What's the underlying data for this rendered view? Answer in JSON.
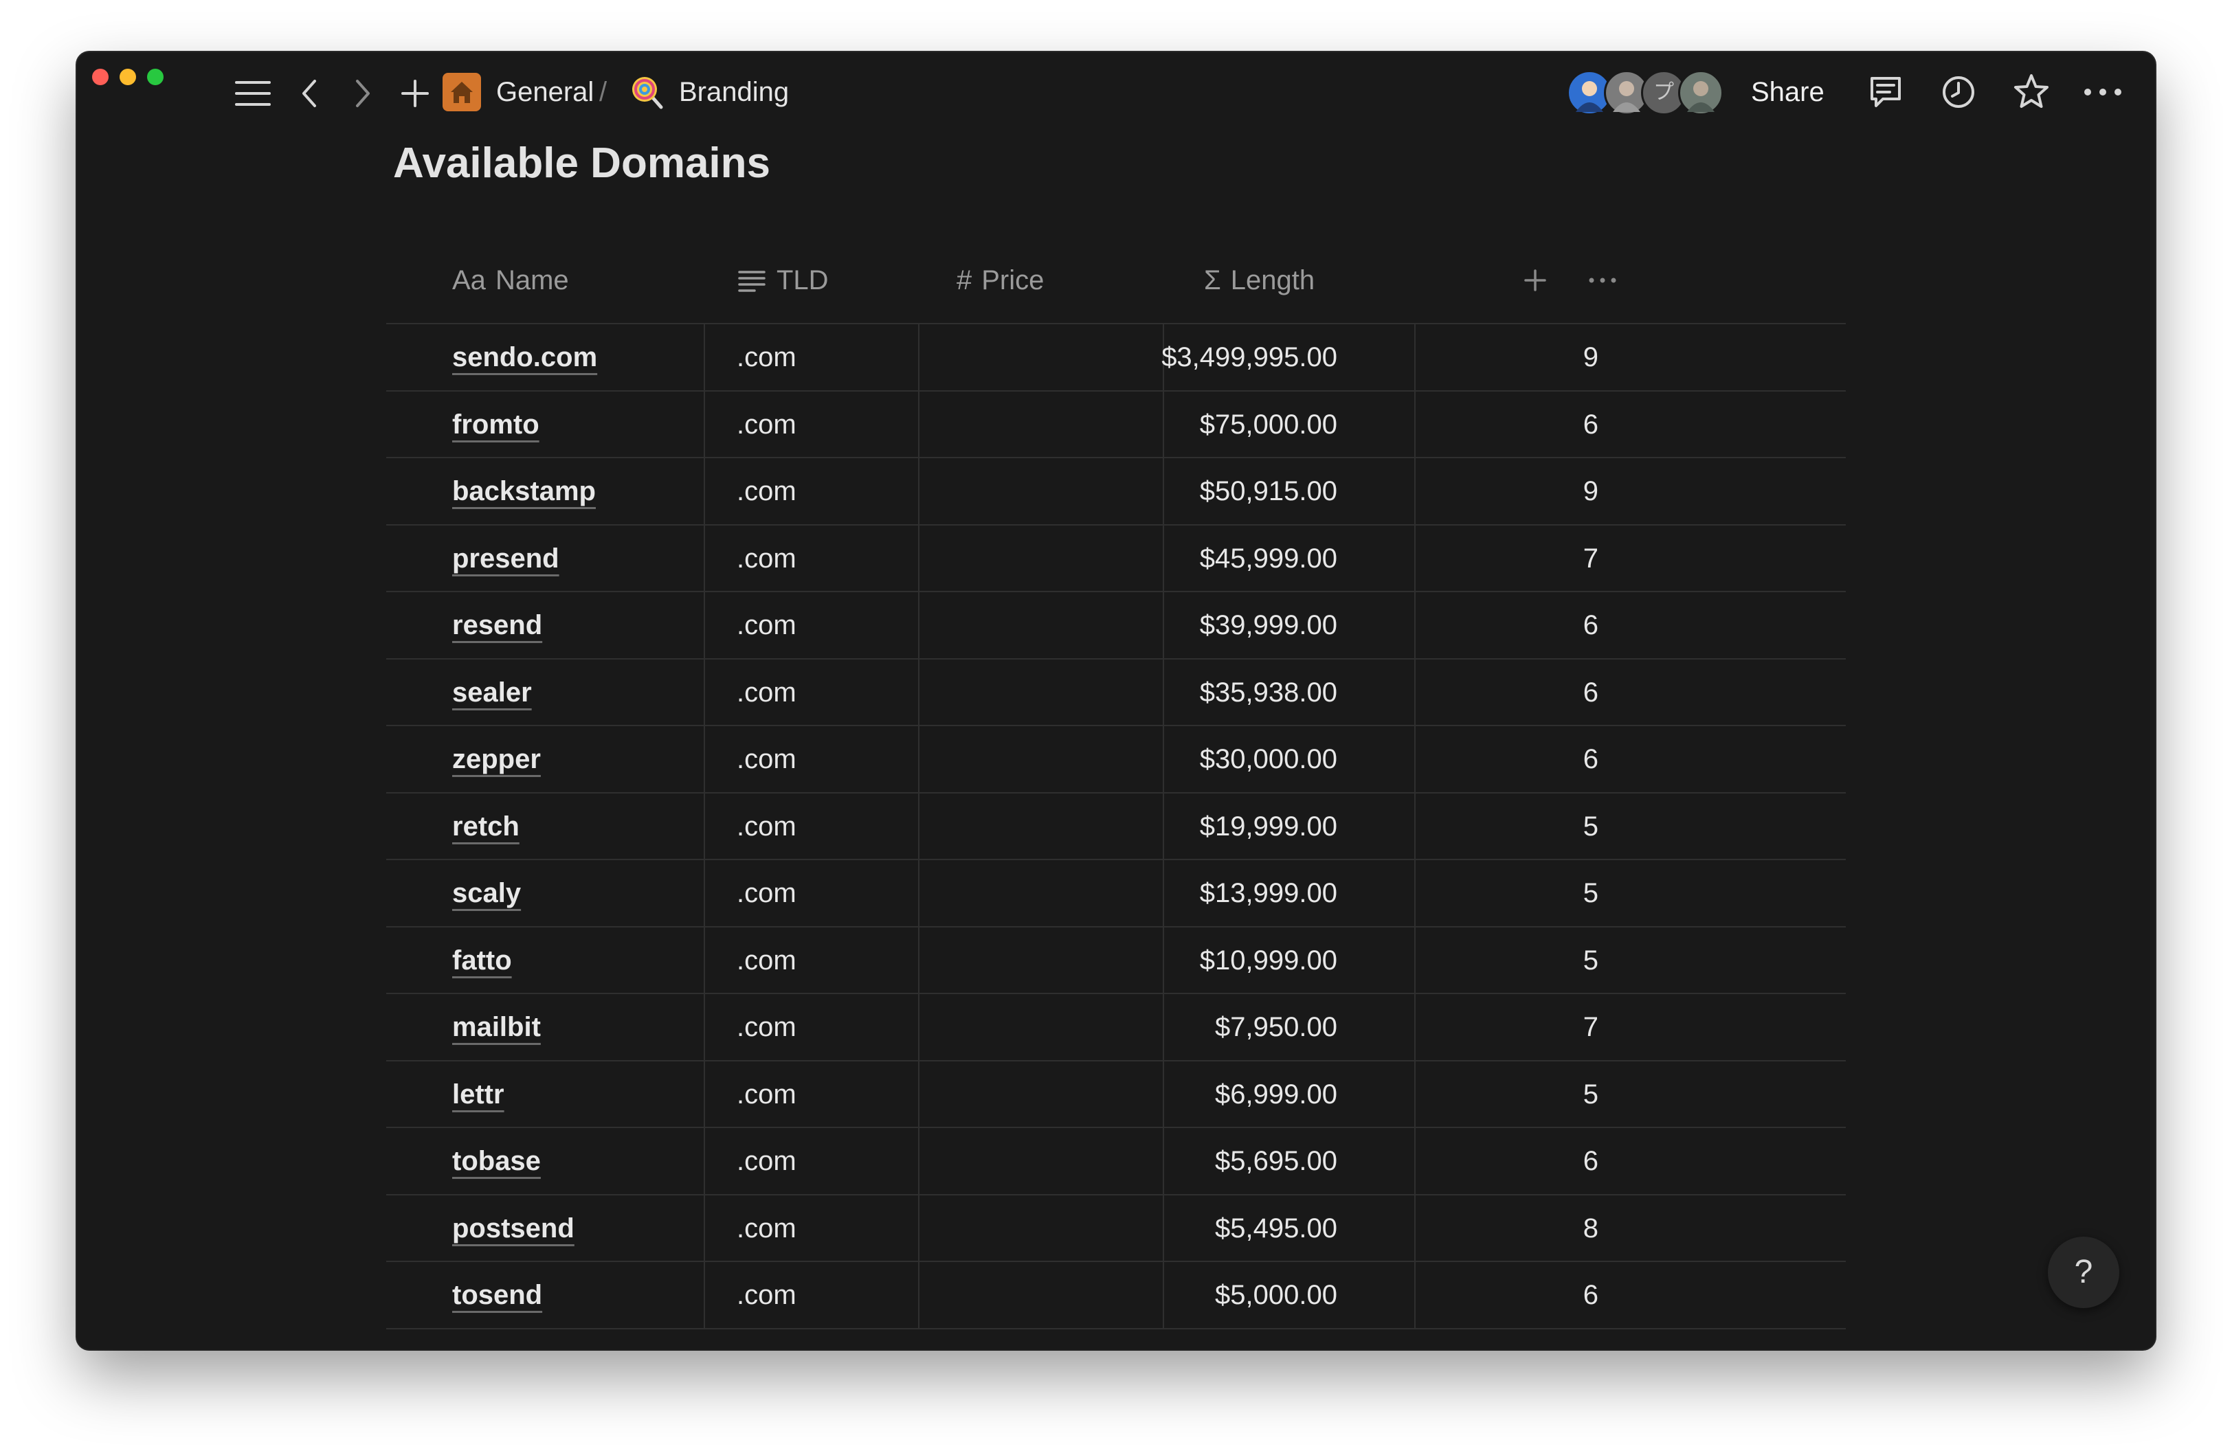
{
  "toolbar": {
    "breadcrumbs": [
      {
        "label": "General",
        "icon": "house-icon"
      },
      {
        "label": "Branding",
        "icon": "lollipop-icon"
      }
    ],
    "separator": "/",
    "share_label": "Share",
    "avatar_initial": "プ"
  },
  "page": {
    "title": "Available Domains"
  },
  "table": {
    "columns": [
      {
        "label": "Name",
        "type_glyph": "Aa"
      },
      {
        "label": "TLD",
        "type_icon": "text-lines-icon"
      },
      {
        "label": "Price",
        "type_glyph": "#"
      },
      {
        "label": "Length",
        "type_glyph": "Σ"
      }
    ],
    "rows": [
      {
        "name": "sendo.com",
        "tld": ".com",
        "price": "$3,499,995.00",
        "length": "9"
      },
      {
        "name": "fromto",
        "tld": ".com",
        "price": "$75,000.00",
        "length": "6"
      },
      {
        "name": "backstamp",
        "tld": ".com",
        "price": "$50,915.00",
        "length": "9"
      },
      {
        "name": "presend",
        "tld": ".com",
        "price": "$45,999.00",
        "length": "7"
      },
      {
        "name": "resend",
        "tld": ".com",
        "price": "$39,999.00",
        "length": "6"
      },
      {
        "name": "sealer",
        "tld": ".com",
        "price": "$35,938.00",
        "length": "6"
      },
      {
        "name": "zepper",
        "tld": ".com",
        "price": "$30,000.00",
        "length": "6"
      },
      {
        "name": "retch",
        "tld": ".com",
        "price": "$19,999.00",
        "length": "5"
      },
      {
        "name": "scaly",
        "tld": ".com",
        "price": "$13,999.00",
        "length": "5"
      },
      {
        "name": "fatto",
        "tld": ".com",
        "price": "$10,999.00",
        "length": "5"
      },
      {
        "name": "mailbit",
        "tld": ".com",
        "price": "$7,950.00",
        "length": "7"
      },
      {
        "name": "lettr",
        "tld": ".com",
        "price": "$6,999.00",
        "length": "5"
      },
      {
        "name": "tobase",
        "tld": ".com",
        "price": "$5,695.00",
        "length": "6"
      },
      {
        "name": "postsend",
        "tld": ".com",
        "price": "$5,495.00",
        "length": "8"
      },
      {
        "name": "tosend",
        "tld": ".com",
        "price": "$5,000.00",
        "length": "6"
      }
    ]
  },
  "help": {
    "label": "?"
  },
  "colors": {
    "window_bg": "#191919",
    "text": "#e8e8e8",
    "muted": "#9b9b9b",
    "divider": "#2f2f2f",
    "house_icon_bg": "#d4762c"
  }
}
